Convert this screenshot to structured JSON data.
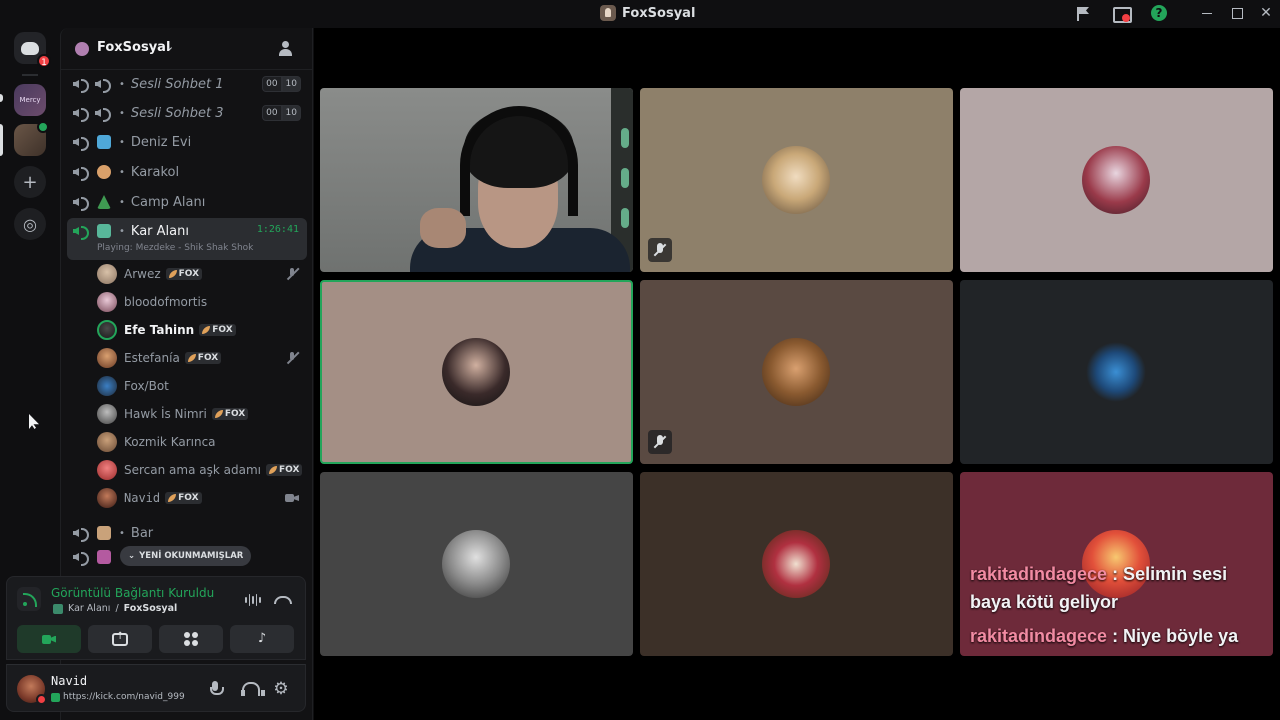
{
  "window": {
    "title": "FoxSosyal"
  },
  "rail": {
    "home_badge": "1",
    "server1_label": "Mercy",
    "add_glyph": "+",
    "explore_glyph": "◎"
  },
  "server": {
    "name": "FoxSosyal",
    "chevron": "⌄"
  },
  "channels": {
    "sesli1": {
      "name": "Sesli Sohbet 1",
      "count": "00",
      "limit": "10"
    },
    "sesli3": {
      "name": "Sesli Sohbet 3",
      "count": "00",
      "limit": "10"
    },
    "deniz": {
      "name": "Deniz Evi"
    },
    "karakol": {
      "name": "Karakol"
    },
    "camp": {
      "name": "Camp Alanı"
    },
    "kar": {
      "name": "Kar Alanı",
      "timer": "1:26:41",
      "activity": "Playing: Mezdeke - Shik Shak Shok"
    },
    "bar": {
      "name": "Bar"
    },
    "dot": "•"
  },
  "members": [
    {
      "name": "Arwez",
      "tag": "FOX",
      "icon": "mic-off-icon"
    },
    {
      "name": "bloodofmortis"
    },
    {
      "name": "Efe Tahinn",
      "tag": "FOX"
    },
    {
      "name": "Estefanía",
      "tag": "FOX",
      "icon": "mic-off-icon"
    },
    {
      "name": "Fox/Bot"
    },
    {
      "name": "Hawk İs Nimri",
      "tag": "FOX"
    },
    {
      "name": "Kozmik Karınca"
    },
    {
      "name": "Sercan ama aşk adamı",
      "tag": "FOX"
    },
    {
      "name": "Navid",
      "tag": "FOX",
      "icon": "camera-icon"
    }
  ],
  "new_unread": {
    "arrow": "⌄",
    "label": "YENİ OKUNMAMIŞLAR"
  },
  "voice": {
    "status": "Görüntülü Bağlantı Kuruldu",
    "channel": "Kar Alanı",
    "sep": "/",
    "server": "FoxSosyal"
  },
  "user": {
    "name": "Navid",
    "status": "https://kick.com/navid_999",
    "gear": "⚙"
  },
  "overlay_chat": [
    {
      "nick": "rakitadindagece",
      "message": " : Selimin sesi baya kötü geliyor"
    },
    {
      "nick": "rakitadindagece",
      "message": " : Niye böyle ya"
    }
  ],
  "colors": {
    "accent_green": "#23a55a",
    "danger_red": "#f23f43",
    "chat_nick": "#f28ba3"
  }
}
